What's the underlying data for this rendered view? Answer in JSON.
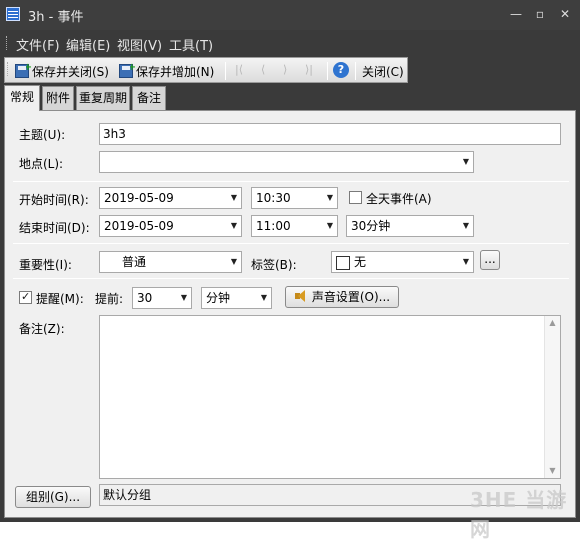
{
  "window": {
    "title": "3h - 事件"
  },
  "menu": [
    "文件(F)",
    "编辑(E)",
    "视图(V)",
    "工具(T)"
  ],
  "toolbar": {
    "save_close": "保存并关闭(S)",
    "save_add": "保存并增加(N)",
    "help": "?",
    "close": "关闭(C)"
  },
  "tabs": [
    "常规",
    "附件",
    "重复周期",
    "备注"
  ],
  "form": {
    "subject_label": "主题(U):",
    "subject_value": "3h3",
    "location_label": "地点(L):",
    "location_value": "",
    "start_label": "开始时间(R):",
    "start_date": "2019-05-09",
    "start_time": "10:30",
    "all_day_label": "全天事件(A)",
    "end_label": "结束时间(D):",
    "end_date": "2019-05-09",
    "end_time": "11:00",
    "duration": "30分钟",
    "importance_label": "重要性(I):",
    "importance_value": "普通",
    "tag_label": "标签(B):",
    "tag_value": "无",
    "tag_more": "...",
    "reminder_label": "提醒(M):",
    "advance_label": "提前:",
    "advance_value": "30",
    "advance_unit": "分钟",
    "sound_button": "声音设置(O)...",
    "notes_label": "备注(Z):",
    "group_button": "组别(G)...",
    "group_value": "默认分组"
  },
  "watermark": "3HE 当游网",
  "colors": {
    "titlebar": "#3e3e3e",
    "content_bg": "#f0f0f0",
    "accent": "#2f74d0"
  }
}
